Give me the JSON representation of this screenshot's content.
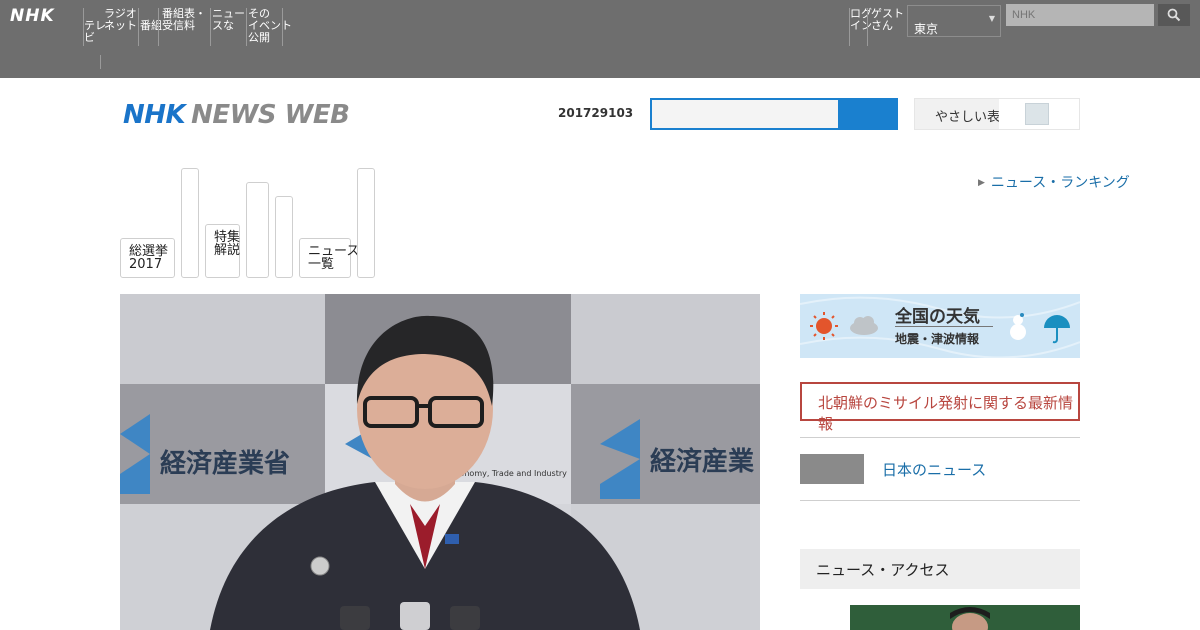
{
  "global_bar": {
    "logo": "NHK",
    "nav": [
      "テレ\nビ",
      "ラジオ\nネット",
      "番組",
      "番組表・\n受信料",
      "ニュー\nスな",
      "その\nイベント\n公開"
    ],
    "right_nav": [
      "ログ\nイン",
      "ゲスト\nさん"
    ],
    "region_select": "東京",
    "search_placeholder": "NHK"
  },
  "header": {
    "brand_nhk": "NHK",
    "brand_rest": "NEWS WEB",
    "date": "201729103",
    "toggle_label": "やさしい表",
    "arrow_link": "ニュース・ランキング"
  },
  "categories": [
    {
      "label": "総選挙\n2017"
    },
    {
      "label": ""
    },
    {
      "label": "特集\n解説"
    },
    {
      "label": ""
    },
    {
      "label": ""
    },
    {
      "label": "ニュース\n一覧"
    },
    {
      "label": ""
    }
  ],
  "weather": {
    "title": "全国の天気",
    "subtitle": "地震・津波情報"
  },
  "sidebar": {
    "alert_text": "北朝鮮のミサイル発射に関する最新情報",
    "gray_link": "日本のニュース",
    "section_title": "ニュース・アクセス"
  },
  "hero": {
    "sign_left": "経済産業省",
    "sign_mid": "Economy, Trade and Industry",
    "sign_right": "経済産業"
  }
}
